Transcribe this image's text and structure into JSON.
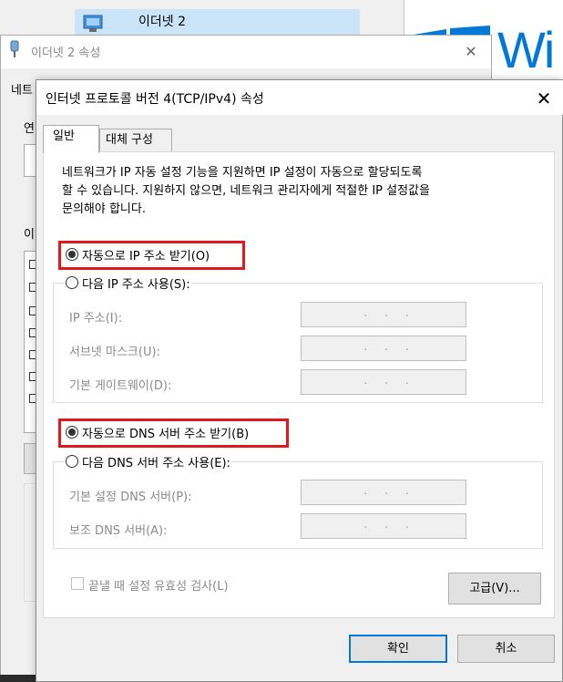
{
  "background_window": {
    "list_item_label": "이더넷 2",
    "logo_text": "Wi"
  },
  "properties_window": {
    "title": "이더넷 2 속성",
    "close_glyph": "✕",
    "tab_fragment": "네트",
    "label_fragment_1": "연",
    "label_fragment_2": "이"
  },
  "dialog": {
    "title": "인터넷 프로토콜 버전 4(TCP/IPv4) 속성",
    "close_glyph": "✕",
    "tabs": [
      {
        "label": "일반",
        "active": true
      },
      {
        "label": "대체 구성",
        "active": false
      }
    ],
    "description": "네트워크가 IP 자동 설정 기능을 지원하면 IP 설정이 자동으로 할당되도록\n할 수 있습니다. 지원하지 않으면, 네트워크 관리자에게 적절한 IP 설정값을\n문의해야 합니다.",
    "ip_mode": {
      "auto_label": "자동으로 IP 주소 받기(O)",
      "manual_label": "다음 IP 주소 사용(S):",
      "selected": "auto",
      "fields": [
        {
          "label": "IP 주소(I):",
          "value": ".     .     ."
        },
        {
          "label": "서브넷 마스크(U):",
          "value": ".     .     ."
        },
        {
          "label": "기본 게이트웨이(D):",
          "value": ".     .     ."
        }
      ]
    },
    "dns_mode": {
      "auto_label": "자동으로 DNS 서버 주소 받기(B)",
      "manual_label": "다음 DNS 서버 주소 사용(E):",
      "selected": "auto",
      "fields": [
        {
          "label": "기본 설정 DNS 서버(P):",
          "value": ".     .     ."
        },
        {
          "label": "보조 DNS 서버(A):",
          "value": ".     .     ."
        }
      ]
    },
    "validate_label": "끝낼 때 설정 유효성 검사(L)",
    "validate_checked": false,
    "advanced_label": "고급(V)...",
    "ok_label": "확인",
    "cancel_label": "취소"
  },
  "colors": {
    "highlight": "#e0191e",
    "accent": "#0078d7",
    "disabled_text": "#8a8a8a"
  }
}
